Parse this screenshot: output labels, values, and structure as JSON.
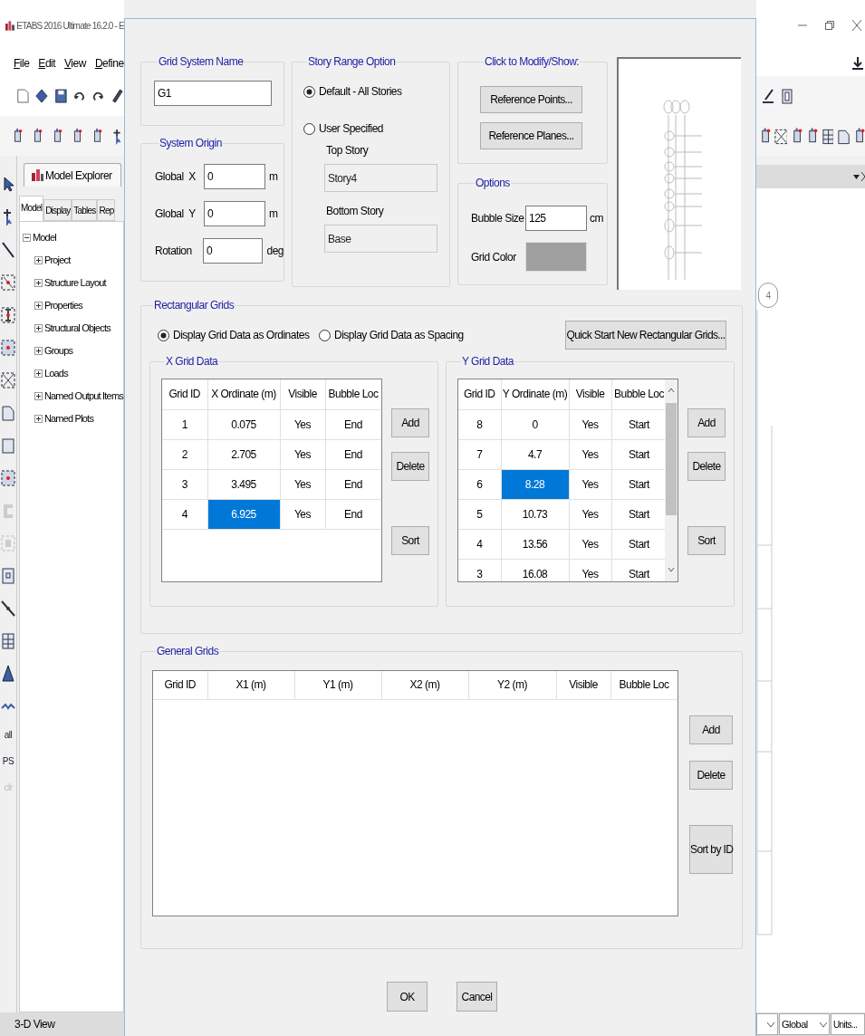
{
  "app": {
    "title": "ETABS 2016 Ultimate 16.2.0 - E",
    "menu": [
      "File",
      "Edit",
      "View",
      "Define"
    ],
    "explorer_title": "Model Explorer",
    "explorer_tabs": [
      {
        "label": "Model",
        "selected": true
      },
      {
        "label": "Display",
        "selected": false
      },
      {
        "label": "Tables",
        "selected": false
      },
      {
        "label": "Rep",
        "selected": false
      }
    ],
    "tree": [
      {
        "label": "Model",
        "expanded": true,
        "children": [
          {
            "label": "Project",
            "expanded": false
          },
          {
            "label": "Structure Layout",
            "expanded": false
          },
          {
            "label": "Properties",
            "expanded": false
          },
          {
            "label": "Structural Objects",
            "expanded": false
          },
          {
            "label": "Groups",
            "expanded": false
          },
          {
            "label": "Loads",
            "expanded": false
          },
          {
            "label": "Named Output Items",
            "expanded": false
          },
          {
            "label": "Named Plots",
            "expanded": false
          }
        ]
      }
    ],
    "select_tools": [
      {
        "label": "all",
        "disabled": false
      },
      {
        "label": "PS",
        "disabled": false
      },
      {
        "label": "clr",
        "disabled": true
      }
    ],
    "grid_bubble": "4",
    "status_left": "3-D View",
    "coord_system": "Global",
    "units_button": "Units..."
  },
  "dialog": {
    "grid_system_name": {
      "title": "Grid System Name",
      "value": "G1"
    },
    "system_origin": {
      "title": "System Origin",
      "fields": [
        {
          "label": "Global  X",
          "value": "0",
          "unit": "m"
        },
        {
          "label": "Global  Y",
          "value": "0",
          "unit": "m"
        },
        {
          "label": "Rotation",
          "value": "0",
          "unit": "deg"
        }
      ]
    },
    "story_range": {
      "title": "Story Range Option",
      "options": [
        {
          "label": "Default - All Stories",
          "selected": true
        },
        {
          "label": "User Specified",
          "selected": false
        }
      ],
      "fields": [
        {
          "label": "Top Story",
          "value": "Story4",
          "disabled": true
        },
        {
          "label": "Bottom Story",
          "value": "Base",
          "disabled": true
        }
      ]
    },
    "modify_show": {
      "title": "Click to Modify/Show:",
      "buttons": [
        "Reference Points...",
        "Reference Planes..."
      ]
    },
    "options": {
      "title": "Options",
      "bubble_size_label": "Bubble Size",
      "bubble_size": "125",
      "bubble_unit": "cm",
      "grid_color_label": "Grid Color"
    },
    "rectangular_grids": {
      "title": "Rectangular Grids",
      "display_options": [
        {
          "label": "Display Grid Data as Ordinates",
          "selected": true
        },
        {
          "label": "Display Grid Data as Spacing",
          "selected": false
        }
      ],
      "quick_start_button": "Quick Start New Rectangular Grids...",
      "x_grid": {
        "title": "X Grid Data",
        "columns": [
          "Grid ID",
          "X Ordinate (m)",
          "Visible",
          "Bubble Loc"
        ],
        "rows": [
          {
            "grid_id": "1",
            "ordinate": "0.075",
            "visible": "Yes",
            "bubble_loc": "End",
            "selected": false
          },
          {
            "grid_id": "2",
            "ordinate": "2.705",
            "visible": "Yes",
            "bubble_loc": "End",
            "selected": false
          },
          {
            "grid_id": "3",
            "ordinate": "3.495",
            "visible": "Yes",
            "bubble_loc": "End",
            "selected": false
          },
          {
            "grid_id": "4",
            "ordinate": "6.925",
            "visible": "Yes",
            "bubble_loc": "End",
            "selected": true
          }
        ],
        "buttons": [
          "Add",
          "Delete",
          "Sort"
        ]
      },
      "y_grid": {
        "title": "Y Grid Data",
        "columns": [
          "Grid ID",
          "Y Ordinate (m)",
          "Visible",
          "Bubble Loc"
        ],
        "rows": [
          {
            "grid_id": "8",
            "ordinate": "0",
            "visible": "Yes",
            "bubble_loc": "Start",
            "selected": false
          },
          {
            "grid_id": "7",
            "ordinate": "4.7",
            "visible": "Yes",
            "bubble_loc": "Start",
            "selected": false
          },
          {
            "grid_id": "6",
            "ordinate": "8.28",
            "visible": "Yes",
            "bubble_loc": "Start",
            "selected": true
          },
          {
            "grid_id": "5",
            "ordinate": "10.73",
            "visible": "Yes",
            "bubble_loc": "Start",
            "selected": false
          },
          {
            "grid_id": "4",
            "ordinate": "13.56",
            "visible": "Yes",
            "bubble_loc": "Start",
            "selected": false
          },
          {
            "grid_id": "3",
            "ordinate": "16.08",
            "visible": "Yes",
            "bubble_loc": "Start",
            "selected": false
          }
        ],
        "buttons": [
          "Add",
          "Delete",
          "Sort"
        ]
      }
    },
    "general_grids": {
      "title": "General Grids",
      "columns": [
        "Grid ID",
        "X1 (m)",
        "Y1 (m)",
        "X2 (m)",
        "Y2 (m)",
        "Visible",
        "Bubble Loc"
      ],
      "buttons": [
        "Add",
        "Delete",
        "Sort by ID"
      ]
    },
    "buttons": [
      "OK",
      "Cancel"
    ]
  }
}
